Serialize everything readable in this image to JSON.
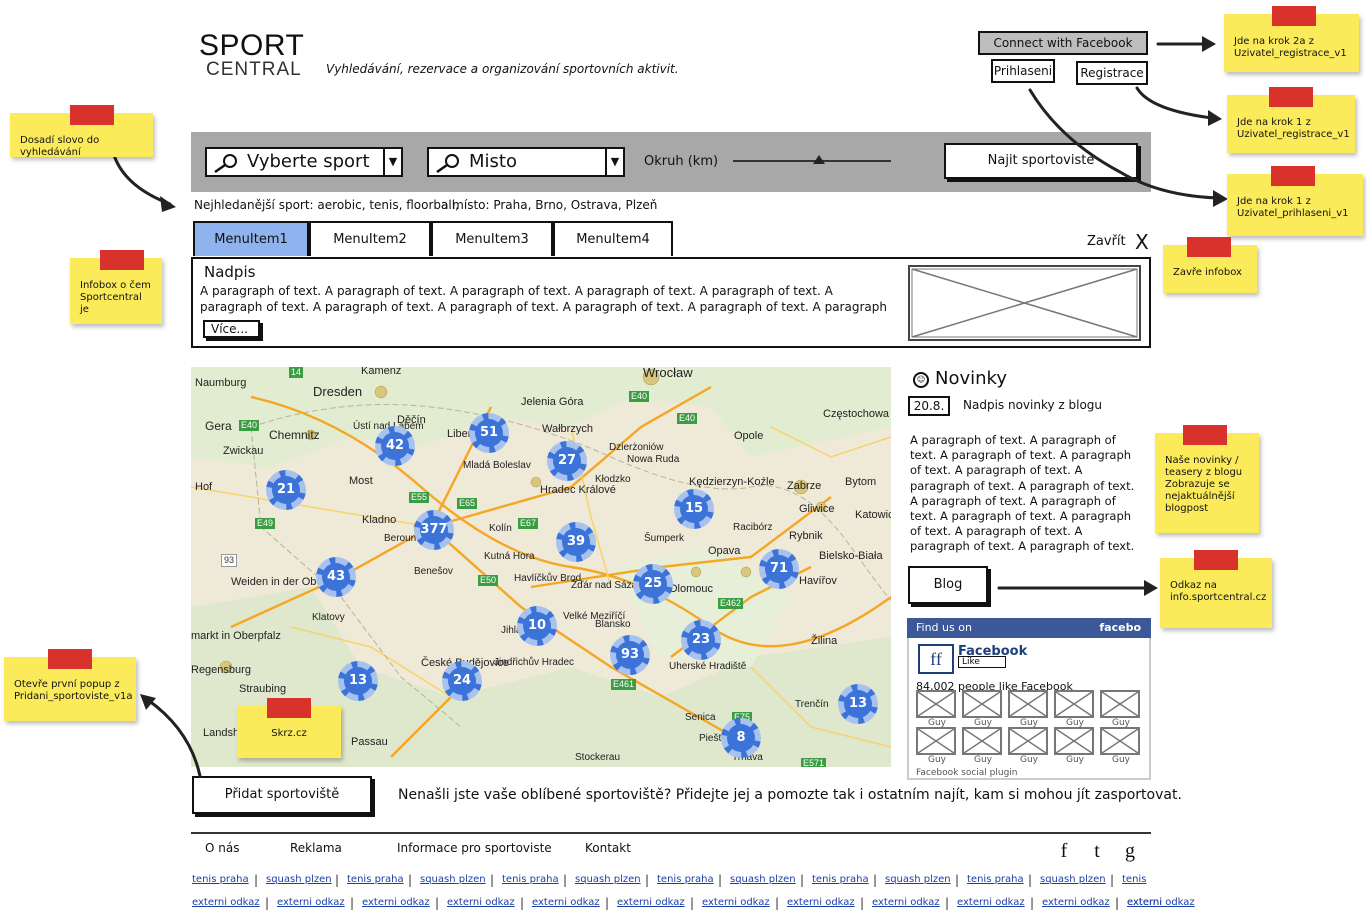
{
  "header": {
    "logo_top": "SPORT",
    "logo_bottom": "CENTRAL",
    "tagline": "Vyhledávání, rezervace a organizování sportovních aktivit.",
    "facebook_connect": "Connect with Facebook",
    "login": "Prihlaseni",
    "register": "Registrace"
  },
  "search": {
    "sport_placeholder": "Vyberte sport",
    "place_placeholder": "Misto",
    "radius_label": "Okruh (km)",
    "find_button": "Najit sportoviste",
    "popular_sports": "Nejhledanější sport: aerobic, tenis, floorball,",
    "popular_places": "a místo: Praha, Brno, Ostrava, Plzeň"
  },
  "tabs": [
    "MenuItem1",
    "MenuItem2",
    "MenuItem3",
    "MenuItem4"
  ],
  "infobox": {
    "close_label": "Zavřít",
    "close_symbol": "X",
    "title": "Nadpis",
    "paragraph": "A paragraph of text. A paragraph of text. A paragraph of text. A paragraph of text. A paragraph of text. A paragraph of text. A paragraph of text. A paragraph of text. A paragraph of text. A paragraph of text. A paragraph of text. A paragraph",
    "more": "Více..."
  },
  "map": {
    "cities": [
      "Naumburg",
      "Kamenz",
      "Wrocław",
      "Dresden",
      "Jelenia Góra",
      "Gera",
      "Chemnitz",
      "Děčín",
      "Ústí nad Labem",
      "Liberec",
      "Wałbrzych",
      "Opole",
      "Częstochowa",
      "Zwickau",
      "Mladá Boleslav",
      "Dzierżoniów",
      "Nowa Ruda",
      "Most",
      "Hradec Králové",
      "Kłodzko",
      "Kędzierzyn-Koźle",
      "Zabrze",
      "Bytom",
      "Hof",
      "Gliwice",
      "Katowice",
      "Kladno",
      "Beroun",
      "Kolín",
      "Racibórz",
      "Rybnik",
      "Kutná Hora",
      "Šumperk",
      "Opava",
      "Bielsko-Biała",
      "Benešov",
      "Havlíčkův Brod",
      "Žďár nad Sázavou",
      "Olomouc",
      "Havířov",
      "Weiden in der Oberpfalz",
      "Klatovy",
      "Jihlava",
      "Velké Meziříčí",
      "Blansko",
      "Žilina",
      "markt in Oberpfalz",
      "Regensburg",
      "České Budějovice",
      "Jindřichův Hradec",
      "Uherské Hradiště",
      "Straubing",
      "Trenčín",
      "Senica",
      "Landshut",
      "Passau",
      "Piešťany",
      "Stockerau",
      "Trnava"
    ],
    "road_signs": [
      "14",
      "E40",
      "E40",
      "E40",
      "E55",
      "E65",
      "E67",
      "E49",
      "E50",
      "E462",
      "E461",
      "93",
      "E571",
      "E75"
    ],
    "clusters": [
      "21",
      "42",
      "51",
      "27",
      "377",
      "39",
      "15",
      "43",
      "25",
      "71",
      "10",
      "93",
      "23",
      "13",
      "24",
      "8",
      "13"
    ]
  },
  "news": {
    "title": "Novinky",
    "date": "20.8.",
    "headline": "Nadpis novinky z blogu",
    "paragraph": "A paragraph of text. A paragraph of text. A paragraph of text. A paragraph of text. A paragraph of text. A paragraph of text. A paragraph of text. A paragraph of text. A paragraph of text. A paragraph of text. A paragraph of text. A paragraph of text. A paragraph of text. A paragraph of text. A",
    "blog_button": "Blog"
  },
  "facebook": {
    "find_us": "Find us on",
    "brand": "facebo",
    "title": "Facebook",
    "like": "Like",
    "count": "84,002 people like Facebook",
    "fan_label": "Guy",
    "plugin": "Facebook social plugin"
  },
  "bottom": {
    "add_button": "Přidat sportoviště",
    "add_text": "Nenašli jste vaše oblíbené sportoviště? Přidejte jej a pomozte tak i ostatním najít, kam si mohou jít zasportovat."
  },
  "footer": {
    "links": [
      "O nás",
      "Reklama",
      "Informace pro sportoviste",
      "Kontakt"
    ],
    "social": [
      "f",
      "t",
      "g"
    ],
    "row1": [
      "tenis praha",
      "squash plzen",
      "tenis praha",
      "squash plzen",
      "tenis praha",
      "squash plzen",
      "tenis praha",
      "squash plzen",
      "tenis praha",
      "squash plzen",
      "tenis praha",
      "squash plzen",
      "tenis"
    ],
    "row2": [
      "externi odkaz",
      "externi odkaz",
      "externi odkaz",
      "externi odkaz",
      "externi odkaz",
      "externi odkaz",
      "externi odkaz",
      "externi odkaz",
      "externi odkaz",
      "externi odkaz",
      "externi odkaz",
      "externi odkaz",
      "externi"
    ],
    "separator": "|"
  },
  "notes": {
    "search_word": "Dosadí slovo do vyhledávání",
    "infobox": "Infobox o čem Sportcentral je",
    "add_popup": "Otevře první popup z Pridani_sportoviste_v1a",
    "skrz": "Skrz.cz",
    "fb_step": "Jde na krok 2a z Uzivatel_registrace_v1",
    "register_step": "Jde na krok 1 z Uzivatel_registrace_v1",
    "login_step": "Jde na krok 1 z Uzivatel_prihlaseni_v1",
    "close_infobox": "Zavře infobox",
    "news_note": "Naše novinky / teasery z blogu Zobrazuje se nejaktuálnější blogpost",
    "blog_link": "Odkaz na info.sportcentral.cz"
  },
  "colors": {
    "active_tab": "#8fb3ef",
    "searchbar": "#a8a8a8",
    "note": "#fbeb5b",
    "tape": "#d8322b",
    "cluster": "#3b73d9",
    "facebook": "#3b5998"
  }
}
